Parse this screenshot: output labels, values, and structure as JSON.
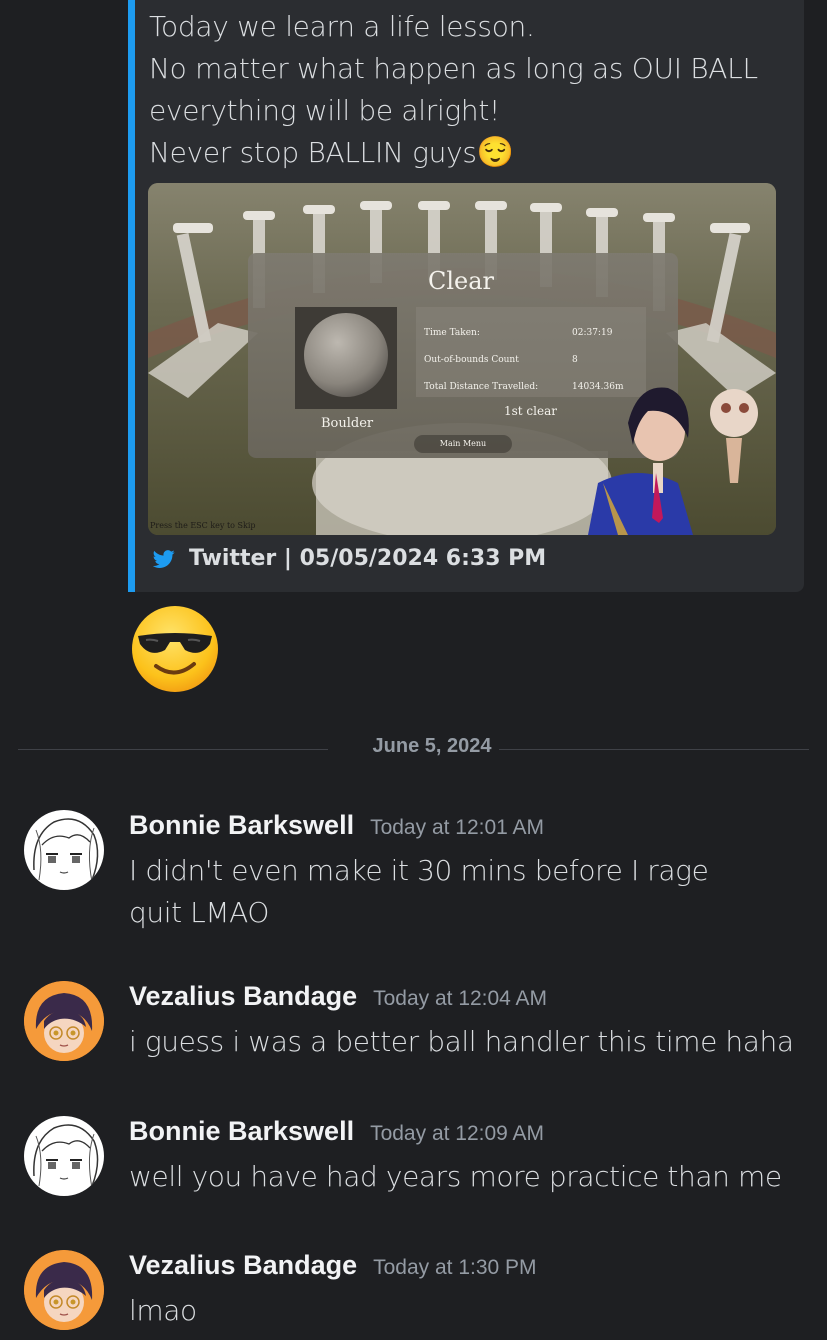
{
  "embed": {
    "accent_color": "#1d9bf0",
    "lines": [
      "Today we learn a life lesson.",
      "No matter what happen as long as OUI BALL",
      "everything will be alright!",
      "Never stop BALLIN guys"
    ],
    "trailing_emoji": "😌",
    "media": {
      "result_title": "Clear",
      "item_name": "Boulder",
      "stats": [
        {
          "label": "Time Taken:",
          "value": "02:37:19"
        },
        {
          "label": "Out-of-bounds Count",
          "value": "8"
        },
        {
          "label": "Total Distance Travelled:",
          "value": "14034.36m"
        }
      ],
      "clear_text": "1st clear",
      "menu_button": "Main Menu",
      "skip_hint": "Press the ESC key to Skip"
    },
    "footer": {
      "icon": "twitter-bird-icon",
      "text": "Twitter | 05/05/2024 6:33 PM"
    }
  },
  "reaction_emoji": "sunglasses-emoji",
  "divider": {
    "date": "June 5, 2024"
  },
  "messages": [
    {
      "username": "Bonnie Barkswell",
      "timestamp": "Today at 12:01 AM",
      "text": "I didn't even make it 30 mins before I rage quit LMAO",
      "avatar": "sketch-avatar"
    },
    {
      "username": "Vezalius Bandage",
      "timestamp": "Today at 12:04 AM",
      "text": "i guess i was a better ball handler this time haha",
      "avatar": "anime-avatar"
    },
    {
      "username": "Bonnie Barkswell",
      "timestamp": "Today at 12:09 AM",
      "text": "well you have had years more practice than me",
      "avatar": "sketch-avatar"
    },
    {
      "username": "Vezalius Bandage",
      "timestamp": "Today at 1:30 PM",
      "text": "lmao",
      "avatar": "anime-avatar"
    }
  ]
}
